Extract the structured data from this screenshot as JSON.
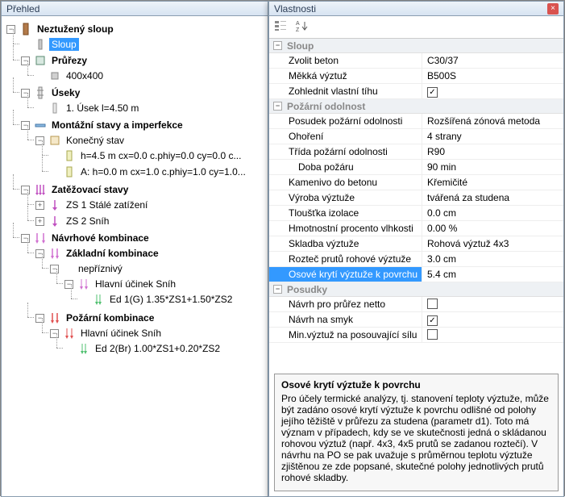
{
  "tree_panel": {
    "title": "Přehled"
  },
  "prop_panel": {
    "title": "Vlastnosti"
  },
  "tree": {
    "root": "Neztužený sloup",
    "sloup": "Sloup",
    "prurezy": "Průřezy",
    "prurez1": "400x400",
    "useky": "Úseky",
    "usek1": "1. Úsek  l=4.50 m",
    "montazni": "Montážní stavy a imperfekce",
    "konecny": "Konečný stav",
    "kst1": "h=4.5 m  cx=0.0 c.phiy=0.0 cy=0.0 c...",
    "kst2": "A: h=0.0 m  cx=1.0 c.phiy=1.0 cy=1.0...",
    "zatezovaci": "Zatěžovací stavy",
    "zs1": "ZS 1 Stálé zatížení",
    "zs2": "ZS 2 Sníh",
    "navrhove": "Návrhové kombinace",
    "zakladni": "Základní kombinace",
    "nepriznivy": "nepříznivý",
    "hlavni1": "Hlavní účinek Sníh",
    "ed1": "Ed 1(G)  1.35*ZS1+1.50*ZS2",
    "pozarni": "Požární kombinace",
    "hlavni2": "Hlavní účinek Sníh",
    "ed2": "Ed 2(Br)  1.00*ZS1+0.20*ZS2"
  },
  "groups": {
    "g1": "Sloup",
    "g2": "Požární odolnost",
    "g3": "Posudky"
  },
  "props": {
    "zvolit_beton_k": "Zvolit beton",
    "zvolit_beton_v": "C30/37",
    "mekka_k": "Měkká výztuž",
    "mekka_v": "B500S",
    "zohlednit_k": "Zohlednit vlastní tíhu",
    "posudek_k": "Posudek požární odolnosti",
    "posudek_v": "Rozšířená zónová metoda",
    "ohoreni_k": "Ohoření",
    "ohoreni_v": "4 strany",
    "trida_k": "Třída požární odolnosti",
    "trida_v": "R90",
    "doba_k": "Doba požáru",
    "doba_v": "90 min",
    "kamenivo_k": "Kamenivo do betonu",
    "kamenivo_v": "Křemičité",
    "vyroba_k": "Výroba výztuže",
    "vyroba_v": "tvářená za studena",
    "tloustka_k": "Tloušťka izolace",
    "tloustka_v": "0.0 cm",
    "hmot_k": "Hmotnostní procento vlhkosti",
    "hmot_v": "0.00 %",
    "skladba_k": "Skladba výztuže",
    "skladba_v": "Rohová výztuž 4x3",
    "roztec_k": "Rozteč prutů rohové výztuže",
    "roztec_v": "3.0 cm",
    "osove_k": "Osové krytí výztuže k povrchu",
    "osove_v": "5.4 cm",
    "navrh_netto_k": "Návrh pro průřez netto",
    "navrh_smyk_k": "Návrh na smyk",
    "min_vyz_k": "Min.výztuž na posouvající sílu"
  },
  "desc": {
    "title": "Osové krytí výztuže k povrchu",
    "body": "Pro účely termické analýzy, tj. stanovení teploty výztuže, může být zadáno osové krytí výztuže k povrchu odlišné od polohy jejího těžiště v průřezu za studena (parametr d1). Toto má význam v případech, kdy se ve skutečnosti jedná o skládanou rohovou výztuž (např. 4x3, 4x5 prutů se zadanou roztečí). V návrhu na PO se pak uvažuje s průměrnou teplotu výztuže zjištěnou ze zde popsané, skutečné polohy jednotlivých prutů rohové skladby."
  },
  "icons": {
    "categorized": "categorized-icon",
    "alpha_sort": "alpha-sort-icon"
  }
}
